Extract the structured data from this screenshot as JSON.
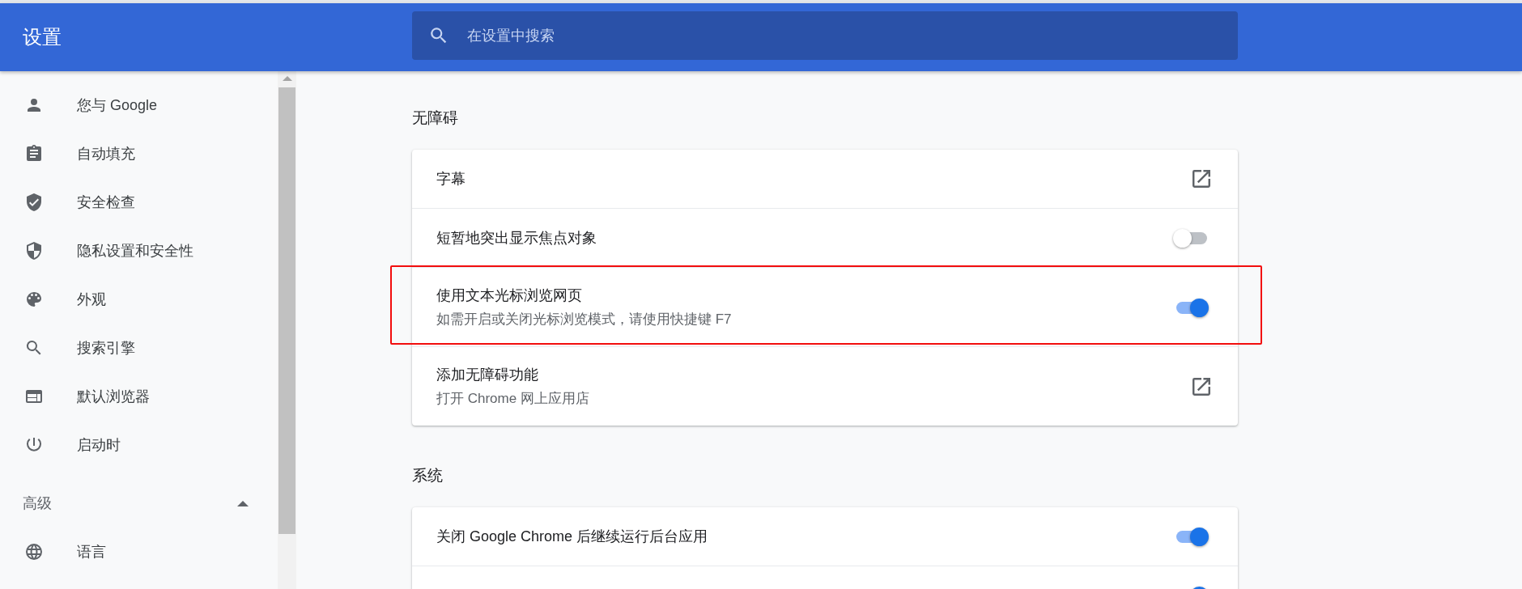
{
  "header": {
    "title": "设置",
    "search": {
      "placeholder": "在设置中搜索"
    }
  },
  "sidebar": {
    "items": [
      {
        "label": "您与 Google",
        "selected": false
      },
      {
        "label": "自动填充",
        "selected": false
      },
      {
        "label": "安全检查",
        "selected": false
      },
      {
        "label": "隐私设置和安全性",
        "selected": false
      },
      {
        "label": "外观",
        "selected": false
      },
      {
        "label": "搜索引擎",
        "selected": false
      },
      {
        "label": "默认浏览器",
        "selected": false
      },
      {
        "label": "启动时",
        "selected": false
      }
    ],
    "advanced": {
      "label": "高级",
      "expanded": true,
      "items": [
        {
          "label": "语言",
          "selected": false
        }
      ]
    }
  },
  "sections": [
    {
      "title": "无障碍",
      "rows": [
        {
          "kind": "link",
          "label": "字幕",
          "highlighted": false
        },
        {
          "kind": "toggle",
          "label": "短暂地突出显示焦点对象",
          "on": false,
          "highlighted": false
        },
        {
          "kind": "toggle",
          "label": "使用文本光标浏览网页",
          "sublabel": "如需开启或关闭光标浏览模式，请使用快捷键 F7",
          "on": true,
          "highlighted": true
        },
        {
          "kind": "link",
          "label": "添加无障碍功能",
          "sublabel": "打开 Chrome 网上应用店",
          "highlighted": false
        }
      ]
    },
    {
      "title": "系统",
      "rows": [
        {
          "kind": "toggle",
          "label": "关闭 Google Chrome 后继续运行后台应用",
          "on": true,
          "highlighted": false
        },
        {
          "kind": "toggle",
          "on": true,
          "highlighted": false
        }
      ]
    }
  ]
}
